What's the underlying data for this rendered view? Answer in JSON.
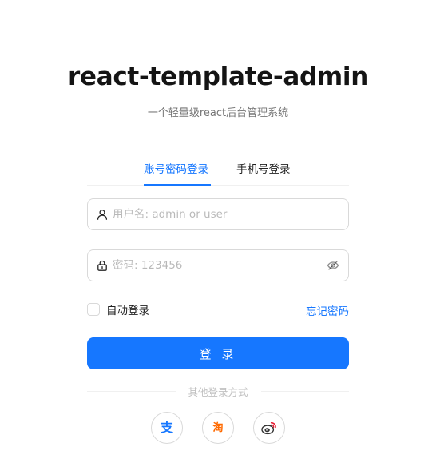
{
  "header": {
    "title": "react-template-admin",
    "subtitle": "一个轻量级react后台管理系统"
  },
  "tabs": [
    {
      "label": "账号密码登录",
      "active": true
    },
    {
      "label": "手机号登录",
      "active": false
    }
  ],
  "form": {
    "username": {
      "value": "",
      "placeholder": "用户名: admin or user",
      "icon": "user-icon"
    },
    "password": {
      "value": "",
      "placeholder": "密码: 123456",
      "icon": "lock-icon",
      "toggle_icon": "eye-invisible-icon"
    },
    "remember": {
      "label": "自动登录",
      "checked": false
    },
    "forgot_label": "忘记密码",
    "submit_label": "登 录"
  },
  "other_login": {
    "label": "其他登录方式",
    "providers": [
      {
        "name": "alipay",
        "glyph": "支",
        "color": "#1677ff",
        "icon": "alipay-icon"
      },
      {
        "name": "taobao",
        "glyph": "淘",
        "color": "#ff6a00",
        "icon": "taobao-icon"
      },
      {
        "name": "weibo",
        "icon": "weibo-icon"
      }
    ]
  },
  "colors": {
    "primary": "#1677ff",
    "border": "#d9d9d9",
    "divider": "#f0f0f0"
  }
}
